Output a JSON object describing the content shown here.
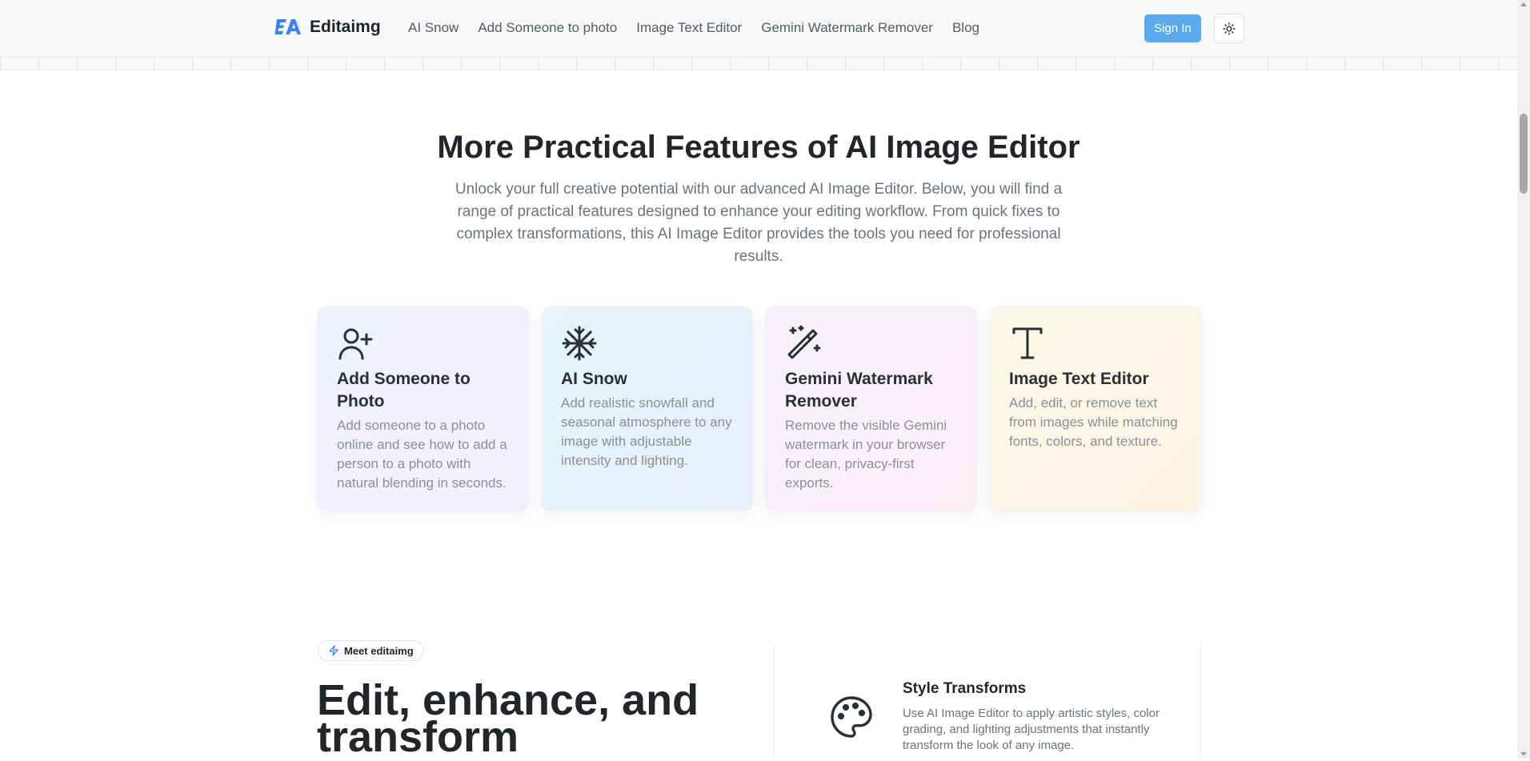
{
  "header": {
    "brand": "Editaimg",
    "nav": [
      "AI Snow",
      "Add Someone to photo",
      "Image Text Editor",
      "Gemini Watermark Remover",
      "Blog"
    ],
    "sign_in": "Sign In",
    "theme_icon": "sun-icon",
    "accent_color": "#5aa9ee"
  },
  "features": {
    "title": "More Practical Features of AI Image Editor",
    "description": "Unlock your full creative potential with our advanced AI Image Editor. Below, you will find a range of practical features designed to enhance your editing workflow. From quick fixes to complex transformations, this AI Image Editor provides the tools you need for professional results.",
    "cards": [
      {
        "icon": "user-plus-icon",
        "title": "Add Someone to Photo",
        "text": "Add someone to a photo online and see how to add a person to a photo with natural blending in seconds."
      },
      {
        "icon": "snowflake-icon",
        "title": "AI Snow",
        "text": "Add realistic snowfall and seasonal atmosphere to any image with adjustable intensity and lighting."
      },
      {
        "icon": "magic-wand-icon",
        "title": "Gemini Watermark Remover",
        "text": "Remove the visible Gemini watermark in your browser for clean, privacy-first exports."
      },
      {
        "icon": "type-icon",
        "title": "Image Text Editor",
        "text": "Add, edit, or remove text from images while matching fonts, colors, and texture."
      }
    ]
  },
  "intro": {
    "badge": "Meet editaimg",
    "badge_icon": "zap-icon",
    "headline": "Edit, enhance, and transform",
    "feature": {
      "icon": "palette-icon",
      "title": "Style Transforms",
      "text": "Use AI Image Editor to apply artistic styles, color grading, and lighting adjustments that instantly transform the look of any image."
    }
  }
}
